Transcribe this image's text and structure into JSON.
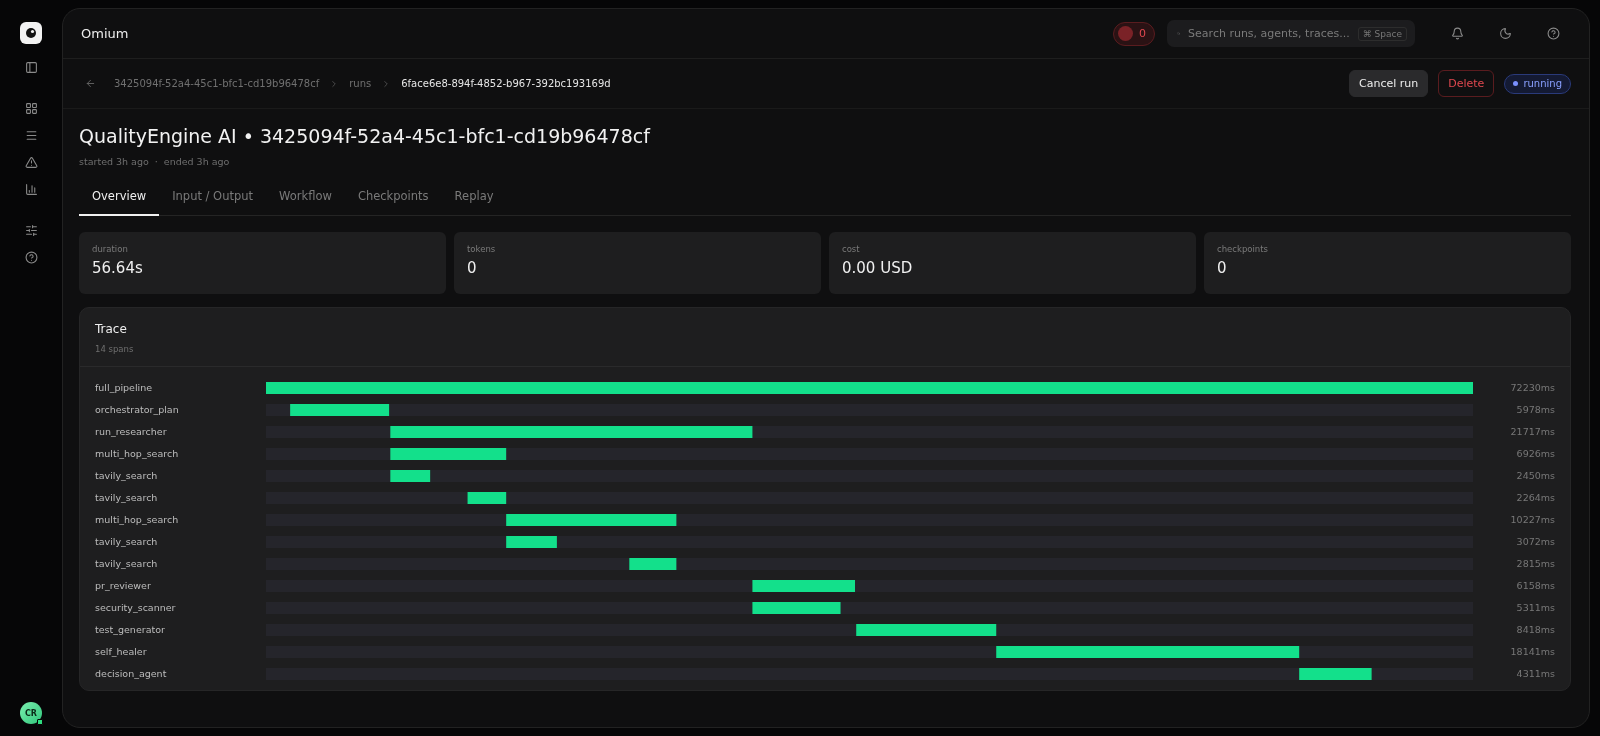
{
  "app": {
    "name": "Omium",
    "avatar": "CR"
  },
  "header": {
    "alerts": "0",
    "search": {
      "placeholder": "Search runs, agents, traces...",
      "shortcut": "⌘ Space"
    }
  },
  "breadcrumb": [
    "3425094f-52a4-45c1-bfc1-cd19b96478cf",
    "runs",
    "6face6e8-894f-4852-b967-392bc193169d"
  ],
  "actions": [
    {
      "label": "Cancel run",
      "kind": "neutral"
    },
    {
      "label": "Delete",
      "kind": "danger"
    }
  ],
  "status": "running",
  "title": "QualityEngine AI • 3425094f-52a4-45c1-bfc1-cd19b96478cf",
  "started": "started 3h ago",
  "separator": "·",
  "ended": "ended 3h ago",
  "tabs": [
    {
      "label": "Overview",
      "selected": true
    },
    {
      "label": "Input / Output",
      "selected": false
    },
    {
      "label": "Workflow",
      "selected": false
    },
    {
      "label": "Checkpoints",
      "selected": false
    },
    {
      "label": "Replay",
      "selected": false
    }
  ],
  "stats": [
    {
      "label": "duration",
      "value": "56.64s"
    },
    {
      "label": "tokens",
      "value": "0"
    },
    {
      "label": "cost",
      "value": "0.00 USD"
    },
    {
      "label": "checkpoints",
      "value": "0"
    }
  ],
  "trace": {
    "title": "Trace",
    "count": "14 spans",
    "spans": [
      {
        "name": "full_pipeline",
        "duration": "72230ms"
      },
      {
        "name": "orchestrator_plan",
        "duration": "5978ms"
      },
      {
        "name": "run_researcher",
        "duration": "21717ms"
      },
      {
        "name": "multi_hop_search",
        "duration": "6926ms"
      },
      {
        "name": "tavily_search",
        "duration": "2450ms"
      },
      {
        "name": "tavily_search",
        "duration": "2264ms"
      },
      {
        "name": "multi_hop_search",
        "duration": "10227ms"
      },
      {
        "name": "tavily_search",
        "duration": "3072ms"
      },
      {
        "name": "tavily_search",
        "duration": "2815ms"
      },
      {
        "name": "pr_reviewer",
        "duration": "6158ms"
      },
      {
        "name": "security_scanner",
        "duration": "5311ms"
      },
      {
        "name": "test_generator",
        "duration": "8418ms"
      },
      {
        "name": "self_healer",
        "duration": "18141ms"
      },
      {
        "name": "decision_agent",
        "duration": "4311ms"
      }
    ]
  }
}
